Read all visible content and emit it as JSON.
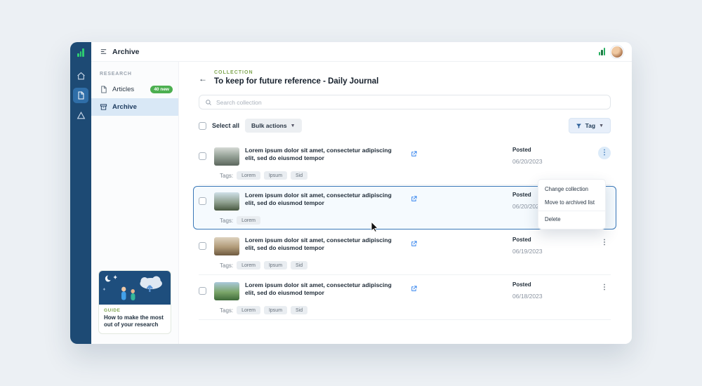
{
  "topbar": {
    "title": "Archive"
  },
  "sidebar": {
    "section": "RESEARCH",
    "items": [
      {
        "label": "Articles",
        "badge": "40 new"
      },
      {
        "label": "Archive"
      }
    ]
  },
  "guide": {
    "eyebrow": "GUIDE",
    "title": "How to make the most out of your research"
  },
  "collection": {
    "eyebrow": "COLLECTION",
    "title": "To keep for future reference - Daily Journal"
  },
  "search": {
    "placeholder": "Search collection"
  },
  "toolbar": {
    "select_all": "Select all",
    "bulk_actions": "Bulk actions",
    "tag_filter": "Tag"
  },
  "rows": [
    {
      "title": "Lorem ipsum dolor sit amet, consectetur adipiscing elit, sed do eiusmod tempor",
      "posted_label": "Posted",
      "date": "06/20/2023",
      "tags_label": "Tags:",
      "tags": [
        "Lorem",
        "Ipsum",
        "Sid"
      ]
    },
    {
      "title": "Lorem ipsum dolor sit amet, consectetur adipiscing elit, sed do eiusmod tempor",
      "posted_label": "Posted",
      "date": "06/20/2023",
      "tags_label": "Tags:",
      "tags": [
        "Lorem"
      ]
    },
    {
      "title": "Lorem ipsum dolor sit amet, consectetur adipiscing elit, sed do eiusmod tempor",
      "posted_label": "Posted",
      "date": "06/19/2023",
      "tags_label": "Tags:",
      "tags": [
        "Lorem",
        "Ipsum",
        "Sid"
      ]
    },
    {
      "title": "Lorem ipsum dolor sit amet, consectetur adipiscing elit, sed do eiusmod tempor",
      "posted_label": "Posted",
      "date": "06/18/2023",
      "tags_label": "Tags:",
      "tags": [
        "Lorem",
        "Ipsum",
        "Sid"
      ]
    }
  ],
  "menu": {
    "items": [
      "Change collection",
      "Move to archived list",
      "Delete"
    ]
  },
  "colors": {
    "rail_navy": "#1d4a74",
    "accent_blue": "#2f80ed",
    "logo_green": "#2ecc71",
    "badge_green": "#4caf50",
    "eyebrow_green": "#7fa650",
    "selected_row_border": "#3a78b8"
  }
}
